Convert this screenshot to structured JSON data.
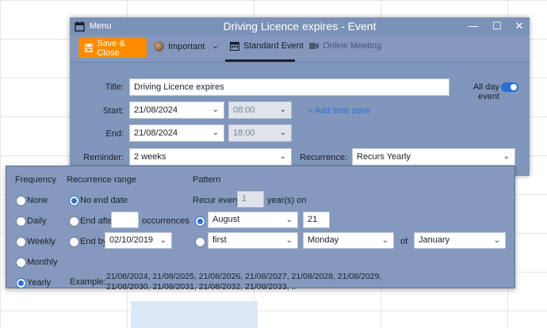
{
  "window": {
    "title": "Driving Licence expires - Event",
    "menu_label": "Menu",
    "controls": {
      "minimize": "—",
      "maximize": "☐",
      "close": "✕"
    }
  },
  "toolbar": {
    "save_close_label": "Save & Close",
    "importance_label": "Important",
    "tab_standard": "Standard Event",
    "tab_online": "Online Meeting"
  },
  "form": {
    "title_label": "Title:",
    "title_value": "Driving Licence expires",
    "all_day_label": "All day event",
    "all_day_on": true,
    "start_label": "Start:",
    "start_date": "21/08/2024",
    "start_time": "08:00",
    "add_timezone": "+ Add time zone",
    "end_label": "End:",
    "end_date": "21/08/2024",
    "end_time": "18:00",
    "reminder_label": "Reminder:",
    "reminder_value": "2 weeks",
    "recurrence_label": "Recurrence:",
    "recurrence_value": "Recurs Yearly"
  },
  "recurrence_panel": {
    "frequency_header": "Frequency",
    "frequency_options": [
      "None",
      "Daily",
      "Weekly",
      "Monthly",
      "Yearly"
    ],
    "frequency_selected": "Yearly",
    "range_header": "Recurrence range",
    "range_no_end": "No end date",
    "range_end_after": "End after",
    "range_occurrences": "occurrences",
    "range_end_by": "End by",
    "range_end_by_date": "02/10/2019",
    "pattern_header": "Pattern",
    "recur_every_label": "Recur every",
    "recur_every_value": "1",
    "recur_every_unit": "year(s) on",
    "month_value": "August",
    "day_value": "21",
    "ordinal_value": "first",
    "weekday_value": "Monday",
    "of_label": "of",
    "of_month_value": "January",
    "example_label": "Example:",
    "example_line1": "21/08/2024, 21/08/2025, 21/08/2026, 21/08/2027, 21/08/2028, 21/08/2029,",
    "example_line2": "21/08/2030, 21/08/2031, 21/08/2032, 21/08/2033, .."
  },
  "colors": {
    "accent": "#2a6fd6",
    "save_button": "#ff8c00",
    "window_bg": "#8096bb"
  }
}
